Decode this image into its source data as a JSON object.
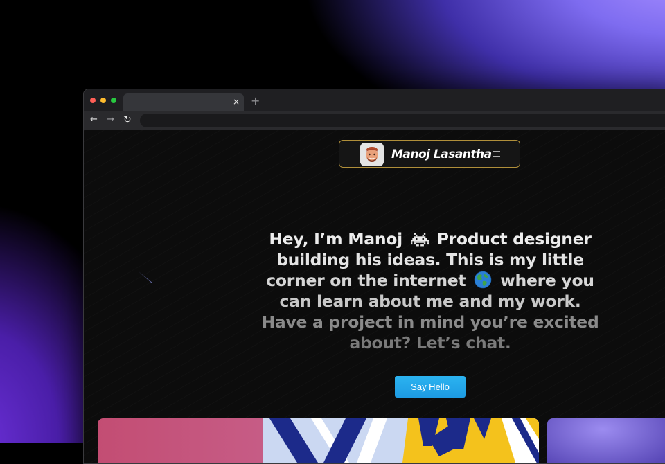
{
  "browser": {
    "tab": {
      "title": "",
      "close_glyph": "×"
    },
    "new_tab_glyph": "+",
    "nav": {
      "back_glyph": "←",
      "forward_glyph": "→",
      "reload_glyph": "↻"
    },
    "address_bar": {
      "value": "",
      "placeholder": ""
    }
  },
  "site": {
    "brand_name": "Manoj Lasantha",
    "avatar_icon": "memoji-avatar-icon",
    "menu_icon": "hamburger-menu-icon",
    "hero": {
      "line1_a": "Hey, I’m Manoj",
      "line1_emoji_icon": "alien-monster-icon",
      "line1_b": "Product designer",
      "line2": "building his ideas. This is my little",
      "line3_a": "corner on the internet",
      "line3_emoji_icon": "globe-icon",
      "line3_b": "where you",
      "line4": "can learn about me and my work.",
      "line5": "Have a project in mind you’re excited",
      "line6": "about? Let’s chat."
    },
    "cta_label": "Say Hello"
  },
  "colors": {
    "accent_button": "#1fa4ea",
    "nav_border": "#b08f3a",
    "background": "#0c0c0c"
  }
}
